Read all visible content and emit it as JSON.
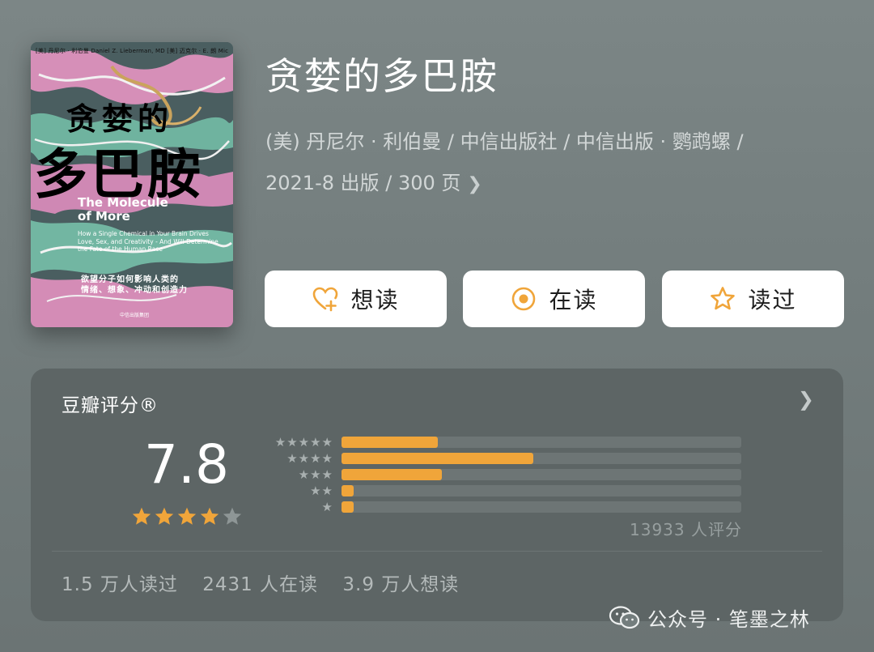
{
  "book": {
    "title": "贪婪的多巴胺",
    "meta_line1": "(美) 丹尼尔 · 利伯曼 / 中信出版社 / 中信出版 · 鹦鹉螺 /",
    "meta_line2": "2021-8 出版 / 300 页",
    "cover": {
      "authors": "[美] 丹尼尔 · 利伯曼 Daniel Z. Lieberman, MD  [美] 迈克尔 · E. 朗 Michael E. Long  著",
      "title_line1": "贪婪的",
      "title_line2": "多巴胺",
      "english_title": "The Molecule of More",
      "english_subtitle": "How a Single Chemical in Your Brain Drives Love, Sex, and Creativity - And Will Determine the Fate of the Human Race",
      "chinese_subtitle_1": "欲望分子如何影响人类的",
      "chinese_subtitle_2": "情绪、想象、冲动和创造力",
      "publisher": "中信出版集团"
    }
  },
  "actions": {
    "want_label": "想读",
    "reading_label": "在读",
    "read_label": "读过"
  },
  "rating": {
    "title": "豆瓣评分®",
    "score": "7.8",
    "stars": 4,
    "max_stars": 5,
    "count_text": "13933 人评分",
    "distribution": [
      {
        "stars": 5,
        "fraction": 0.24
      },
      {
        "stars": 4,
        "fraction": 0.48
      },
      {
        "stars": 3,
        "fraction": 0.25
      },
      {
        "stars": 2,
        "fraction": 0.03
      },
      {
        "stars": 1,
        "fraction": 0.03
      }
    ],
    "read_count": "1.5 万人读过",
    "reading_count": "2431 人在读",
    "want_count": "3.9 万人想读"
  },
  "watermark": {
    "text": "公众号 · 笔墨之林"
  },
  "colors": {
    "accent": "#f0a53a",
    "star_empty": "#8e9696",
    "card_bg": "#5d6565"
  }
}
